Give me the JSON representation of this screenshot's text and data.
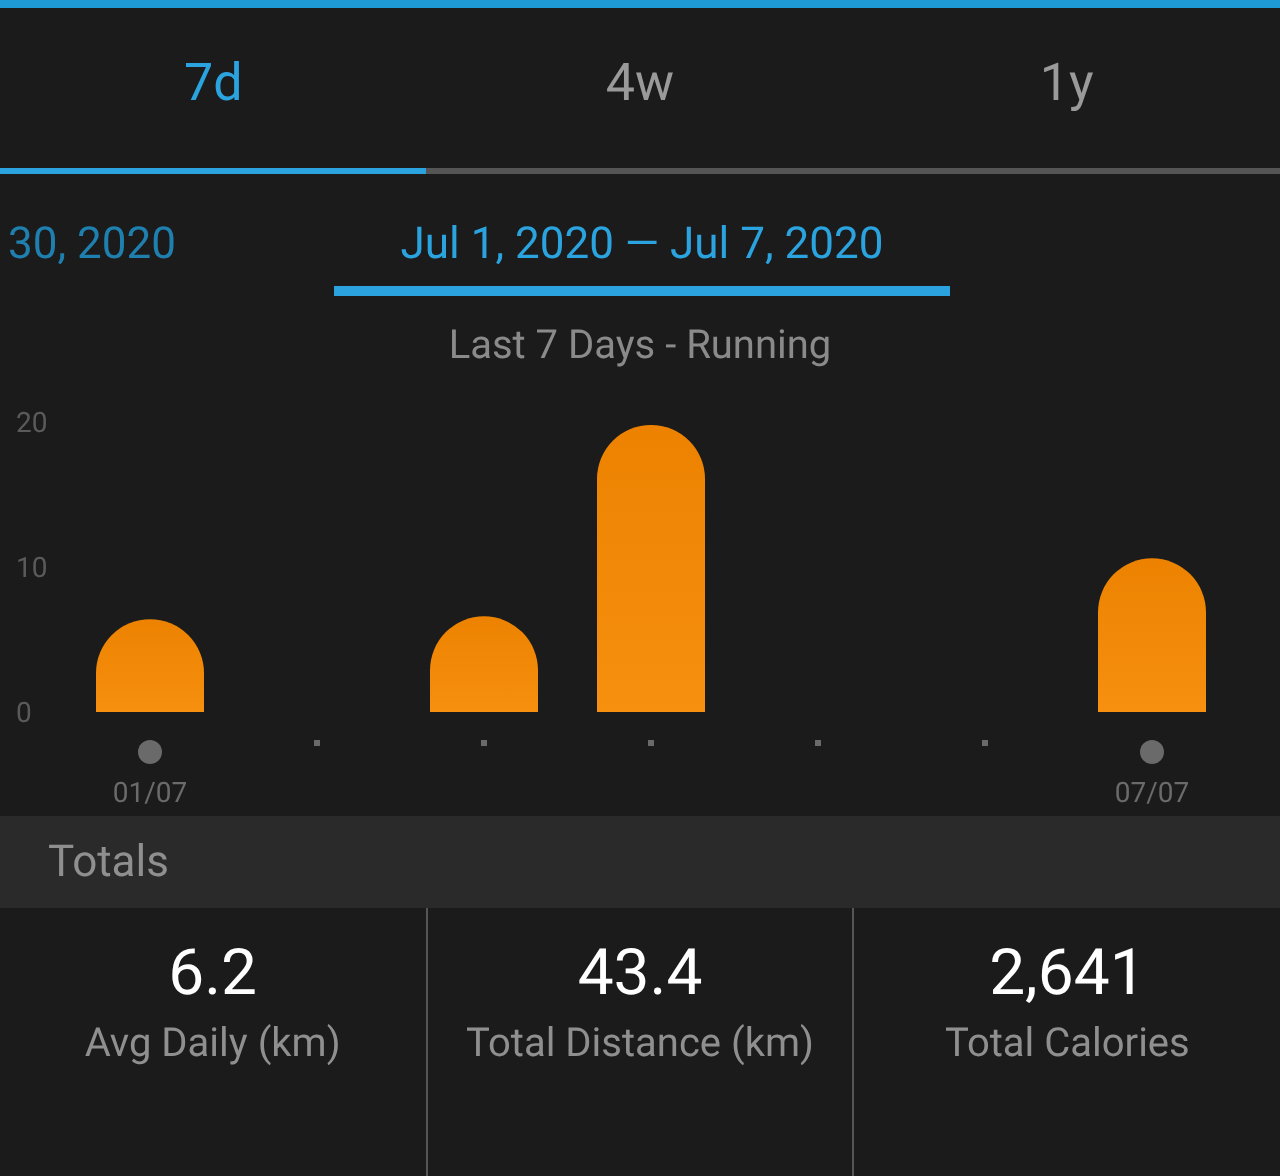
{
  "tabs": [
    {
      "label": "7d",
      "selected": true
    },
    {
      "label": "4w",
      "selected": false
    },
    {
      "label": "1y",
      "selected": false
    }
  ],
  "date_ranges": [
    {
      "label": "30, 2020",
      "selected": false
    },
    {
      "label": "Jul 1, 2020 — Jul 7, 2020",
      "selected": true
    }
  ],
  "chart_title": "Last 7 Days - Running",
  "chart_data": {
    "type": "bar",
    "categories": [
      "01/07",
      null,
      null,
      null,
      null,
      null,
      "07/07"
    ],
    "series": [
      {
        "color": "#f7900f",
        "values": [
          6.4,
          null,
          6.6,
          19.8,
          null,
          null,
          10.6
        ]
      }
    ],
    "ylim": [
      0,
      20
    ],
    "yticks": [
      0,
      10,
      20
    ]
  },
  "totals": {
    "heading": "Totals",
    "stats": [
      {
        "value": "6.2",
        "label": "Avg Daily (km)"
      },
      {
        "value": "43.4",
        "label": "Total Distance (km)"
      },
      {
        "value": "2,641",
        "label": "Total Calories"
      }
    ]
  }
}
